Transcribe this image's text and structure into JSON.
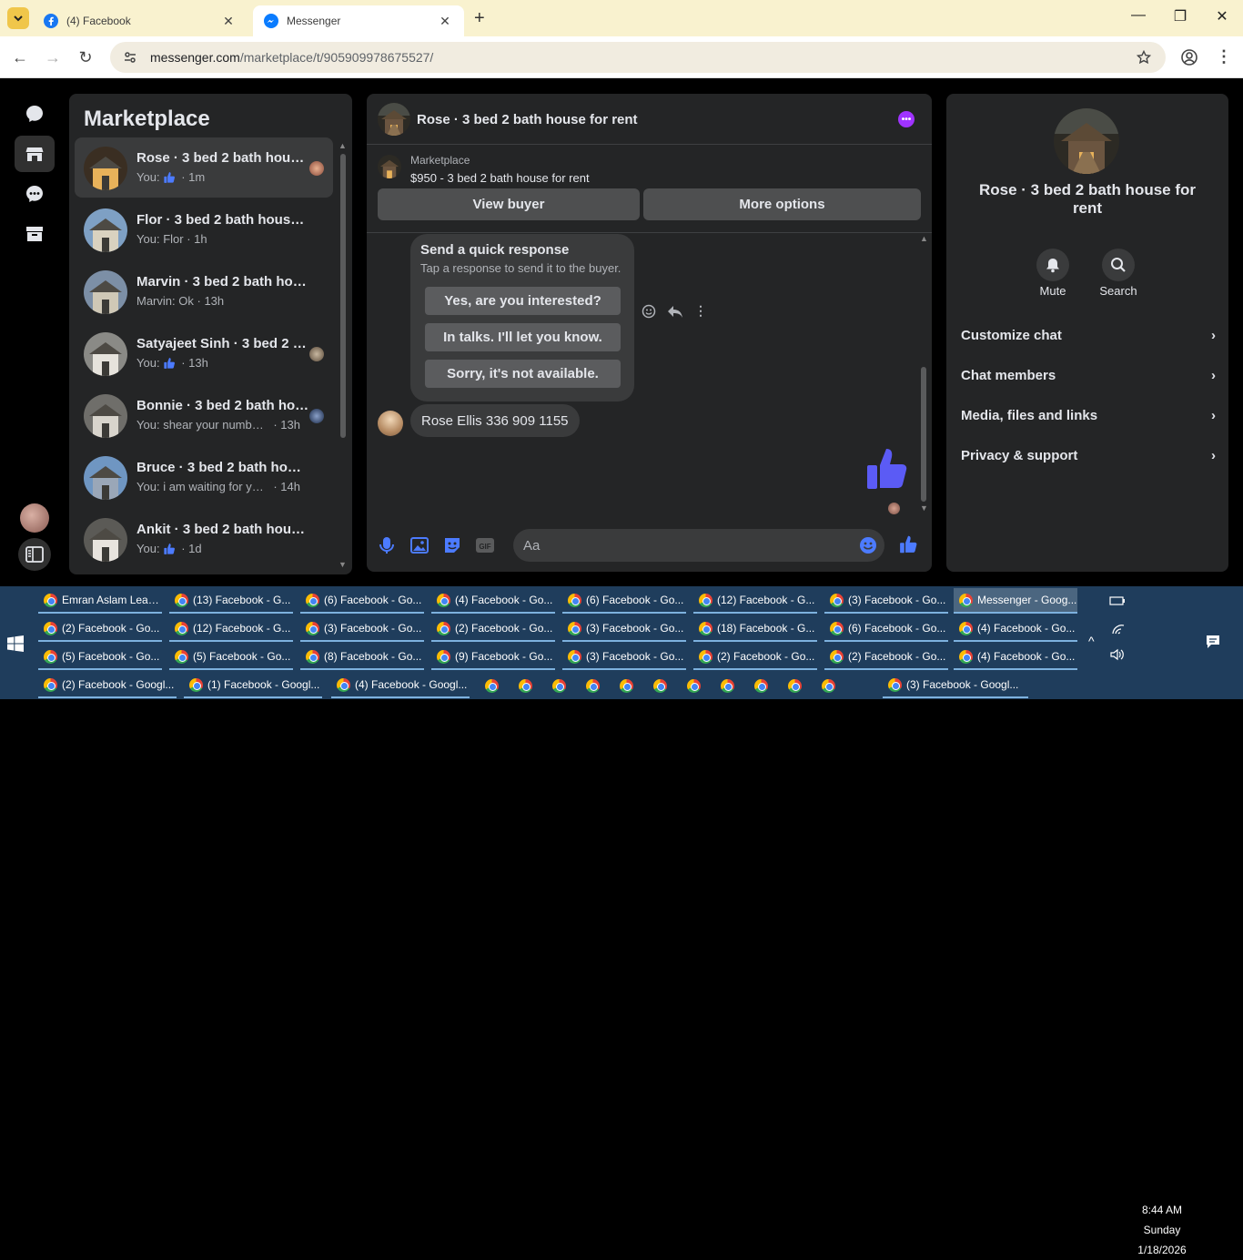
{
  "browser": {
    "tabs": [
      {
        "title": "(4) Facebook",
        "icon": "facebook-icon",
        "active": false
      },
      {
        "title": "Messenger",
        "icon": "messenger-icon",
        "active": true
      }
    ],
    "url_host": "messenger.com",
    "url_path": "/marketplace/t/905909978675527/"
  },
  "sidebar": {
    "title": "Marketplace",
    "conversations": [
      {
        "name": "Rose · 3 bed 2 bath house for rent",
        "prefix": "You:",
        "text": "",
        "like": true,
        "time": "· 1m",
        "selected": true
      },
      {
        "name": "Flor · 3 bed 2 bath house for rent",
        "prefix": "You:",
        "text": "Flor",
        "like": false,
        "time": "· 1h"
      },
      {
        "name": "Marvin · 3 bed 2 bath house for rent",
        "prefix": "Marvin:",
        "text": "Ok",
        "like": false,
        "time": "· 13h"
      },
      {
        "name": "Satyajeet Sinh · 3 bed 2 bath house for rent",
        "prefix": "You:",
        "text": "",
        "like": true,
        "time": "· 13h"
      },
      {
        "name": "Bonnie · 3 bed 2 bath house for rent",
        "prefix": "You:",
        "text": "shear your number ...",
        "like": false,
        "time": "· 13h"
      },
      {
        "name": "Bruce · 3 bed 2 bath house for rent",
        "prefix": "You:",
        "text": "i am waiting for you...",
        "like": false,
        "time": "· 14h"
      },
      {
        "name": "Ankit · 3 bed 2 bath house for rent",
        "prefix": "You:",
        "text": "",
        "like": true,
        "time": "· 1d"
      }
    ]
  },
  "chat": {
    "header_title": "Rose · 3 bed 2 bath house for rent",
    "listing_source": "Marketplace",
    "listing_title": "$950 - 3 bed 2 bath house for rent",
    "view_buyer": "View buyer",
    "more_options": "More options",
    "quick_response": {
      "title": "Send a quick response",
      "subtitle": "Tap a response to send it to the buyer.",
      "options": [
        "Yes, are you interested?",
        "In talks. I'll let you know.",
        "Sorry, it's not available."
      ]
    },
    "message": "Rose Ellis 336 909 1155",
    "composer_placeholder": "Aa"
  },
  "details": {
    "title": "Rose · 3 bed 2 bath house for rent",
    "mute": "Mute",
    "search": "Search",
    "rows": [
      "Customize chat",
      "Chat members",
      "Media, files and links",
      "Privacy & support"
    ]
  },
  "taskbar": {
    "rows": [
      [
        "Emran Aslam Lead...",
        "(13) Facebook - G...",
        "(6) Facebook - Go...",
        "(4) Facebook - Go...",
        "(6) Facebook - Go...",
        "(12) Facebook - G...",
        "(3) Facebook - Go...",
        "Messenger - Goog..."
      ],
      [
        "(2) Facebook - Go...",
        "(12) Facebook - G...",
        "(3) Facebook - Go...",
        "(2) Facebook - Go...",
        "(3) Facebook - Go...",
        "(18) Facebook - G...",
        "(6) Facebook - Go...",
        "(4) Facebook - Go..."
      ],
      [
        "(5) Facebook - Go...",
        "(5) Facebook - Go...",
        "(8) Facebook - Go...",
        "(9) Facebook - Go...",
        "(3) Facebook - Go...",
        "(2) Facebook - Go...",
        "(2) Facebook - Go...",
        "(4) Facebook - Go..."
      ]
    ],
    "row4_left": [
      "(2) Facebook - Googl...",
      "(1) Facebook - Googl...",
      "(4) Facebook - Googl..."
    ],
    "row4_right": "(3) Facebook - Googl...",
    "clock_time": "8:44 AM",
    "clock_day": "Sunday",
    "clock_date": "1/18/2026"
  }
}
